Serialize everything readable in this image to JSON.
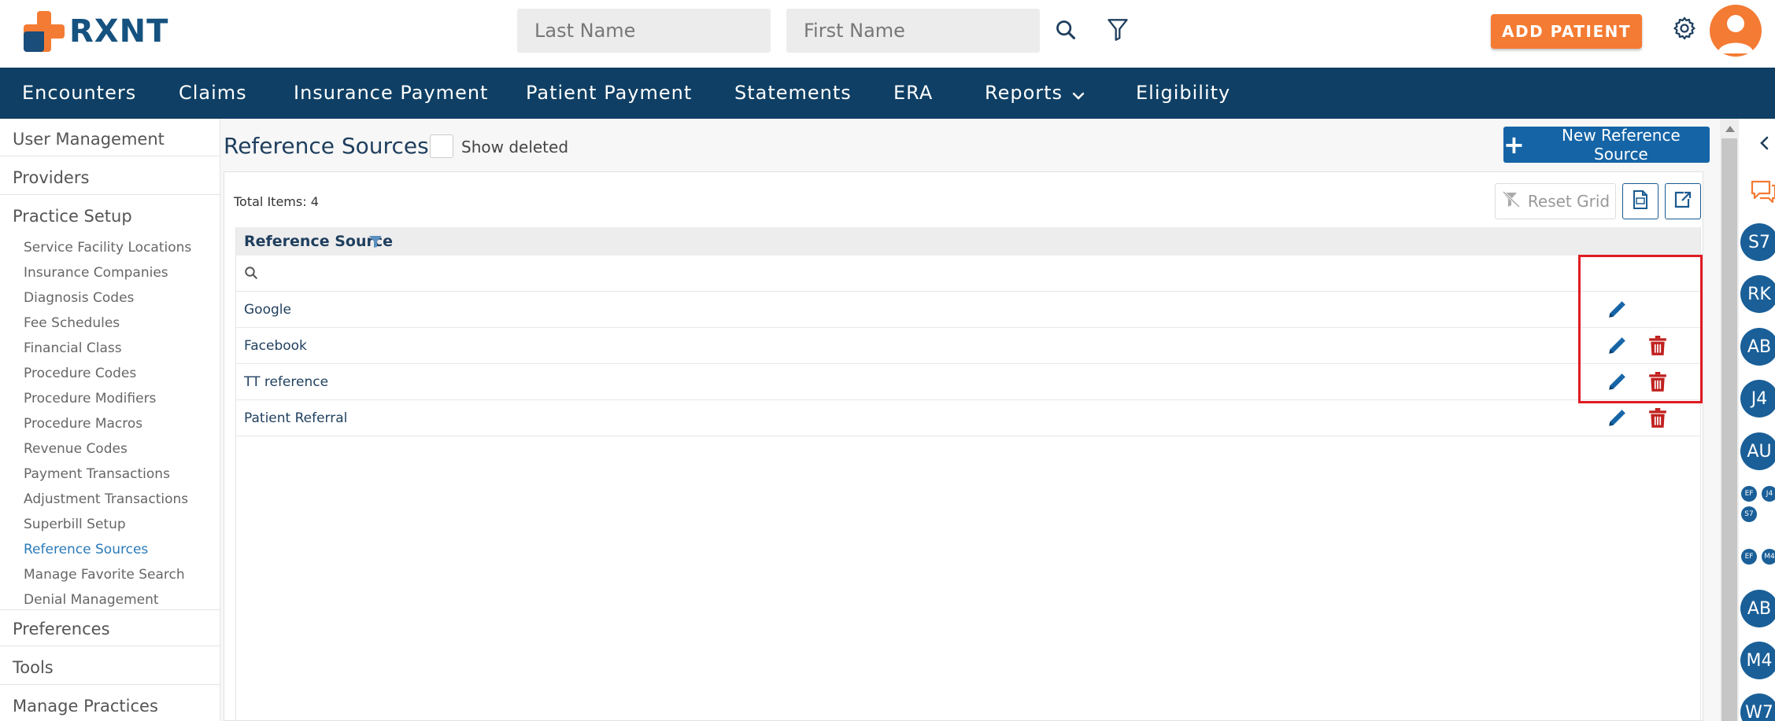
{
  "brand": {
    "logo_text": "RXNT"
  },
  "header": {
    "last_name_placeholder": "Last Name",
    "first_name_placeholder": "First Name",
    "add_patient_label": "ADD PATIENT"
  },
  "nav": {
    "items": [
      "Encounters",
      "Claims",
      "Insurance Payment",
      "Patient Payment",
      "Statements",
      "ERA",
      "Reports",
      "Eligibility"
    ]
  },
  "sidebar": {
    "top_items": [
      "User Management",
      "Providers",
      "Practice Setup"
    ],
    "practice_setup_items": [
      "Service Facility Locations",
      "Insurance Companies",
      "Diagnosis Codes",
      "Fee Schedules",
      "Financial Class",
      "Procedure Codes",
      "Procedure Modifiers",
      "Procedure Macros",
      "Revenue Codes",
      "Payment Transactions",
      "Adjustment Transactions",
      "Superbill Setup",
      "Reference Sources",
      "Manage Favorite Search",
      "Denial Management"
    ],
    "active_item": "Reference Sources",
    "bottom_items": [
      "Preferences",
      "Tools",
      "Manage Practices"
    ]
  },
  "page": {
    "title": "Reference Sources",
    "show_deleted_label": "Show deleted",
    "new_button_label": "New Reference Source",
    "total_items": "Total Items: 4",
    "reset_grid_label": "Reset Grid"
  },
  "grid": {
    "column_header": "Reference Source",
    "rows": [
      {
        "label": "Google",
        "can_delete": false
      },
      {
        "label": "Facebook",
        "can_delete": true
      },
      {
        "label": "TT reference",
        "can_delete": true
      },
      {
        "label": "Patient Referral",
        "can_delete": true
      }
    ]
  },
  "right_panel": {
    "avatars": [
      "S7",
      "RK",
      "AB",
      "J4",
      "AU"
    ],
    "mini_group_1": [
      "EF",
      "J4",
      "S7"
    ],
    "mini_group_2": [
      "EF",
      "M4"
    ],
    "avatars_lower": [
      "AB",
      "M4",
      "W7"
    ]
  },
  "colors": {
    "brand_orange": "#f47b33",
    "nav_bg": "#0f3f64",
    "primary_blue": "#1564a6",
    "delete_red": "#c0201e",
    "highlight_red": "#e01b24"
  }
}
